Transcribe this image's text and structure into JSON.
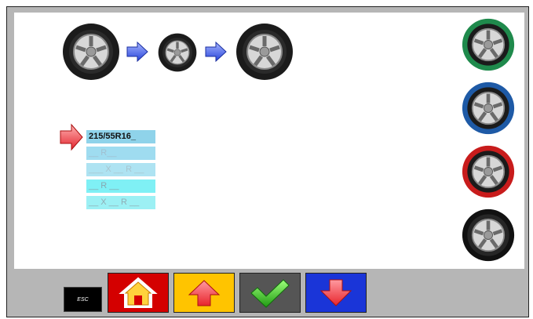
{
  "tire_size": {
    "value": "215/55R16_",
    "rows": [
      "__ R__",
      "___ X __ R __",
      "__ R __",
      "__ X __ R __"
    ]
  },
  "buttons": {
    "esc_label": "ESC"
  },
  "colors": {
    "frame_gray": "#b6b6b6",
    "home_red": "#d40000",
    "up_yellow": "#ffc400",
    "confirm_gray": "#555555",
    "down_blue": "#1a35d8",
    "ring_green": "#1f8a4c",
    "ring_blue": "#1e5aa6",
    "ring_red": "#c81c1c",
    "ring_black": "#111111"
  },
  "icons": {
    "home": "home-icon",
    "up": "arrow-up-icon",
    "confirm": "checkmark-icon",
    "down": "arrow-down-icon",
    "pointer": "arrow-right-icon"
  }
}
